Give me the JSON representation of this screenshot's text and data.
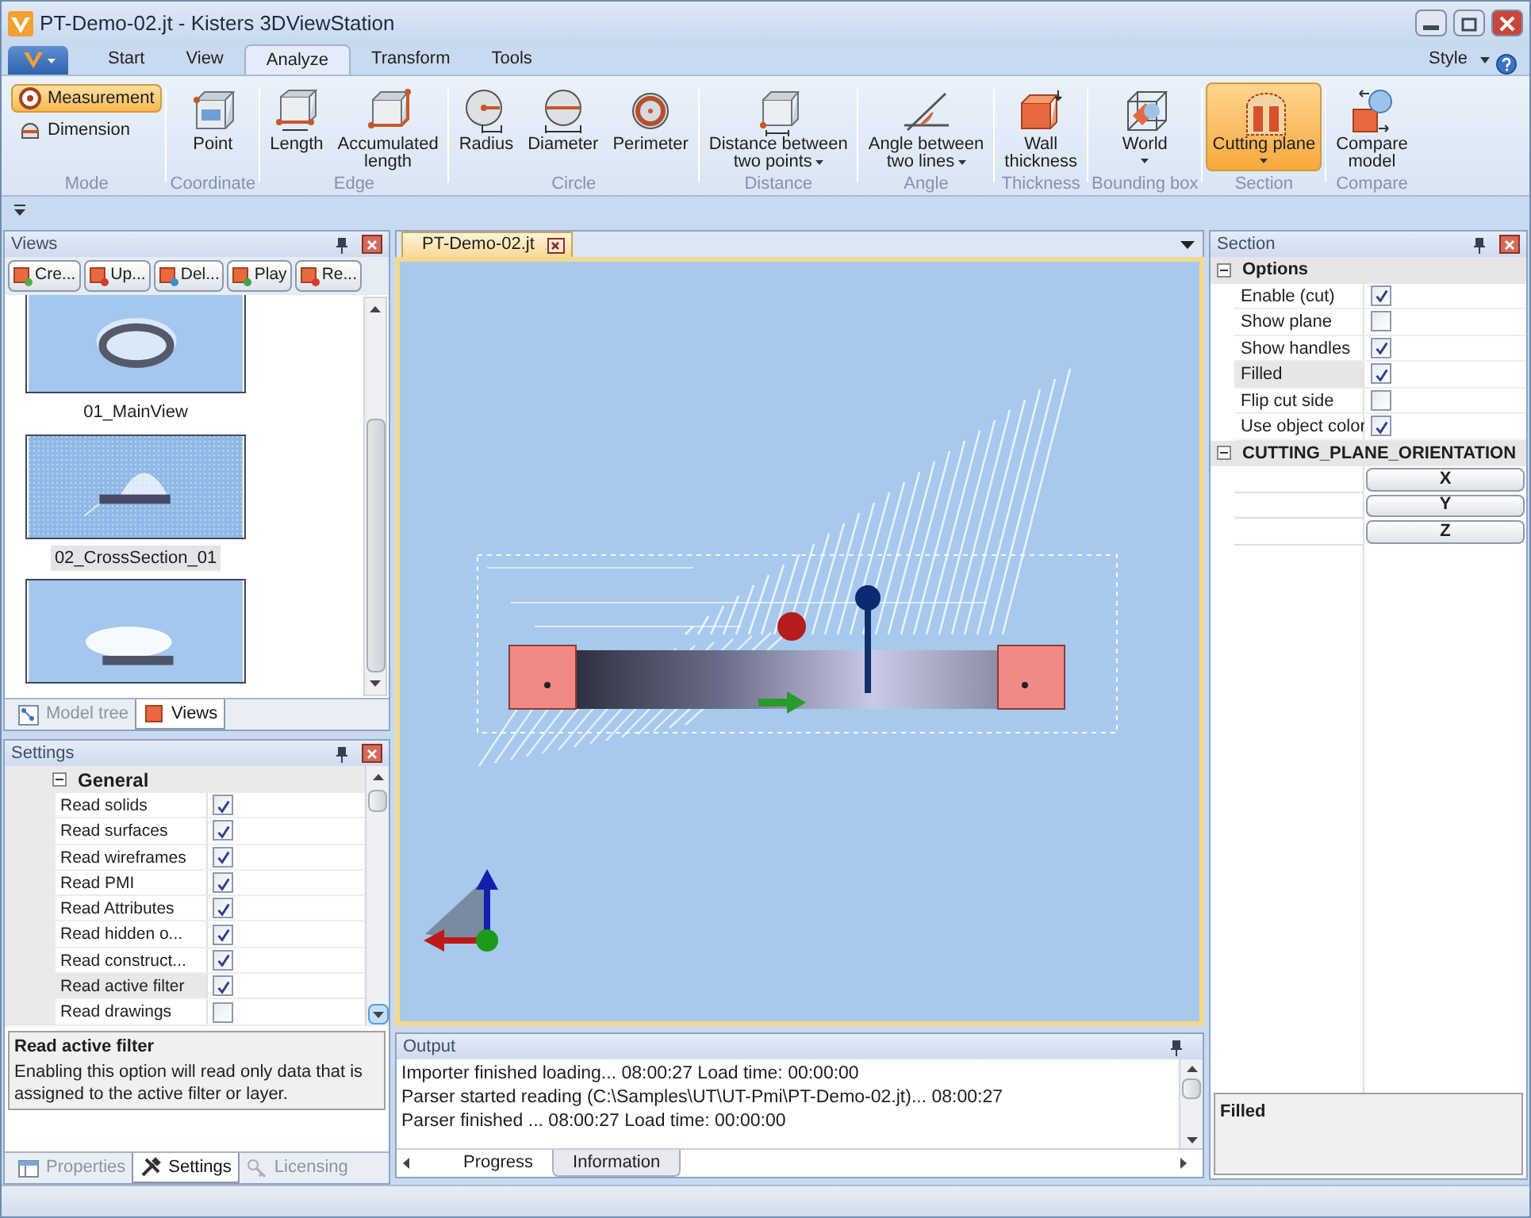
{
  "window": {
    "title": "PT-Demo-02.jt - Kisters 3DViewStation"
  },
  "ribbon_tabs": [
    {
      "label": "Start",
      "selected": false
    },
    {
      "label": "View",
      "selected": false
    },
    {
      "label": "Analyze",
      "selected": true
    },
    {
      "label": "Transform",
      "selected": false
    },
    {
      "label": "Tools",
      "selected": false
    }
  ],
  "style_menu": {
    "label": "Style"
  },
  "ribbon_groups": [
    {
      "label": "Mode",
      "items": [
        {
          "kind": "small",
          "lines": [
            "Measurement"
          ],
          "selected": true
        },
        {
          "kind": "small",
          "lines": [
            "Dimension"
          ],
          "selected": false
        }
      ]
    },
    {
      "label": "Coordinate",
      "items": [
        {
          "kind": "large",
          "lines": [
            "Point"
          ],
          "selected": false,
          "dropdown": false
        }
      ]
    },
    {
      "label": "Edge",
      "items": [
        {
          "kind": "large",
          "lines": [
            "Length"
          ],
          "selected": false,
          "dropdown": false
        },
        {
          "kind": "large",
          "lines": [
            "Accumulated",
            "length"
          ],
          "selected": false,
          "dropdown": false
        }
      ]
    },
    {
      "label": "Circle",
      "items": [
        {
          "kind": "large",
          "lines": [
            "Radius"
          ],
          "selected": false,
          "dropdown": false
        },
        {
          "kind": "large",
          "lines": [
            "Diameter"
          ],
          "selected": false,
          "dropdown": false
        },
        {
          "kind": "large",
          "lines": [
            "Perimeter"
          ],
          "selected": false,
          "dropdown": false
        }
      ]
    },
    {
      "label": "Distance",
      "items": [
        {
          "kind": "large",
          "lines": [
            "Distance between",
            "two points"
          ],
          "selected": false,
          "dropdown": true
        }
      ]
    },
    {
      "label": "Angle",
      "items": [
        {
          "kind": "large",
          "lines": [
            "Angle between",
            "two lines"
          ],
          "selected": false,
          "dropdown": true
        }
      ]
    },
    {
      "label": "Thickness",
      "items": [
        {
          "kind": "large",
          "lines": [
            "Wall",
            "thickness"
          ],
          "selected": false,
          "dropdown": false
        }
      ]
    },
    {
      "label": "Bounding box",
      "items": [
        {
          "kind": "large",
          "lines": [
            "World"
          ],
          "selected": false,
          "dropdown": true
        }
      ]
    },
    {
      "label": "Section",
      "items": [
        {
          "kind": "large",
          "lines": [
            "Cutting plane"
          ],
          "selected": true,
          "dropdown": true
        }
      ]
    },
    {
      "label": "Compare",
      "items": [
        {
          "kind": "large",
          "lines": [
            "Compare",
            "model"
          ],
          "selected": false,
          "dropdown": false
        }
      ]
    }
  ],
  "views_panel": {
    "title": "Views",
    "toolbar": [
      "Cre...",
      "Up...",
      "Del...",
      "Play",
      "Re..."
    ],
    "thumbnails": [
      {
        "label": "01_MainView",
        "selected": false
      },
      {
        "label": "02_CrossSection_01",
        "selected": true
      },
      {
        "selected": false
      }
    ],
    "tabs": [
      {
        "label": "Model tree",
        "selected": false
      },
      {
        "label": "Views",
        "selected": true
      }
    ]
  },
  "settings_panel": {
    "title": "Settings",
    "category": {
      "label": "General",
      "expanded": true
    },
    "rows": [
      {
        "label": "Read solids",
        "checked": true,
        "selected": false
      },
      {
        "label": "Read surfaces",
        "checked": true,
        "selected": false
      },
      {
        "label": "Read wireframes",
        "checked": true,
        "selected": false
      },
      {
        "label": "Read PMI",
        "checked": true,
        "selected": false
      },
      {
        "label": "Read Attributes",
        "checked": true,
        "selected": false
      },
      {
        "label": "Read hidden o...",
        "checked": true,
        "selected": false
      },
      {
        "label": "Read construct...",
        "checked": true,
        "selected": false
      },
      {
        "label": "Read active filter",
        "checked": true,
        "selected": true
      },
      {
        "label": "Read drawings",
        "checked": false,
        "selected": false
      }
    ],
    "description": {
      "title": "Read active filter",
      "text": "Enabling this option will read only data that is assigned to the active filter or layer."
    },
    "tabs": [
      {
        "label": "Properties",
        "selected": false
      },
      {
        "label": "Settings",
        "selected": true
      },
      {
        "label": "Licensing",
        "selected": false
      }
    ]
  },
  "document_tab": {
    "label": "PT-Demo-02.jt"
  },
  "output_panel": {
    "title": "Output",
    "lines": [
      "Importer finished loading... 08:00:27 Load time: 00:00:00",
      "Parser started reading (C:\\Samples\\UT\\UT-Pmi\\PT-Demo-02.jt)... 08:00:27",
      "Parser finished ... 08:00:27 Load time: 00:00:00"
    ],
    "tabs": [
      {
        "label": "Progress",
        "selected": true
      },
      {
        "label": "Information",
        "selected": false
      }
    ]
  },
  "section_panel": {
    "title": "Section",
    "options": {
      "label": "Options",
      "expanded": true,
      "rows": [
        {
          "label": "Enable (cut)",
          "checked": true,
          "selected": false
        },
        {
          "label": "Show plane",
          "checked": false,
          "selected": false
        },
        {
          "label": "Show handles",
          "checked": true,
          "selected": false
        },
        {
          "label": "Filled",
          "checked": true,
          "selected": true
        },
        {
          "label": "Flip cut side",
          "checked": false,
          "selected": false
        },
        {
          "label": "Use object color",
          "checked": true,
          "selected": false
        }
      ]
    },
    "orientation": {
      "label": "CUTTING_PLANE_ORIENTATION",
      "expanded": true,
      "buttons": [
        "X",
        "Y",
        "Z"
      ]
    },
    "description": {
      "title": "Filled"
    }
  }
}
